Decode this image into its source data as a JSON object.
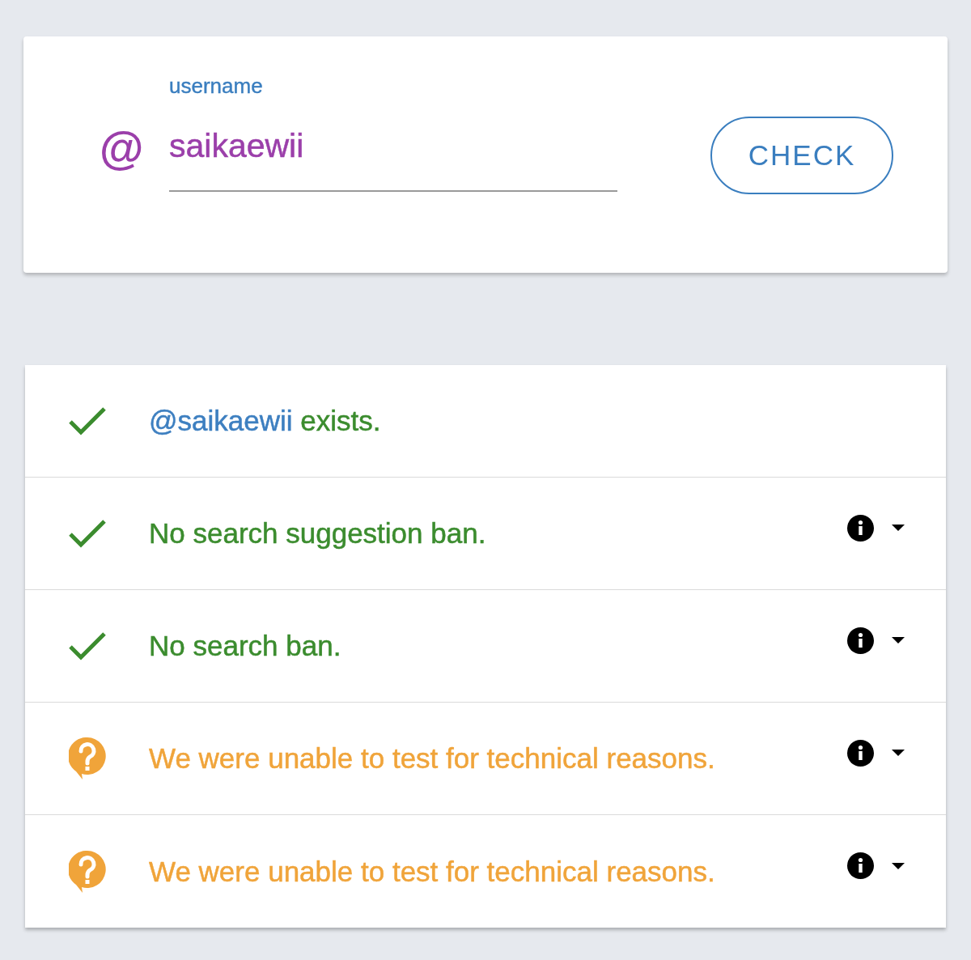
{
  "form": {
    "label": "username",
    "prefix": "@",
    "value": "saikaewii",
    "button": "CHECK"
  },
  "results": [
    {
      "kind": "passed",
      "handle": "@saikaewii",
      "text": "exists.",
      "expandable": false
    },
    {
      "kind": "passed",
      "text": "No search suggestion ban.",
      "expandable": true
    },
    {
      "kind": "passed",
      "text": "No search ban.",
      "expandable": true
    },
    {
      "kind": "unknown",
      "text": "We were unable to test for technical reasons.",
      "expandable": true
    },
    {
      "kind": "unknown",
      "text": "We were unable to test for technical reasons.",
      "expandable": true
    }
  ]
}
